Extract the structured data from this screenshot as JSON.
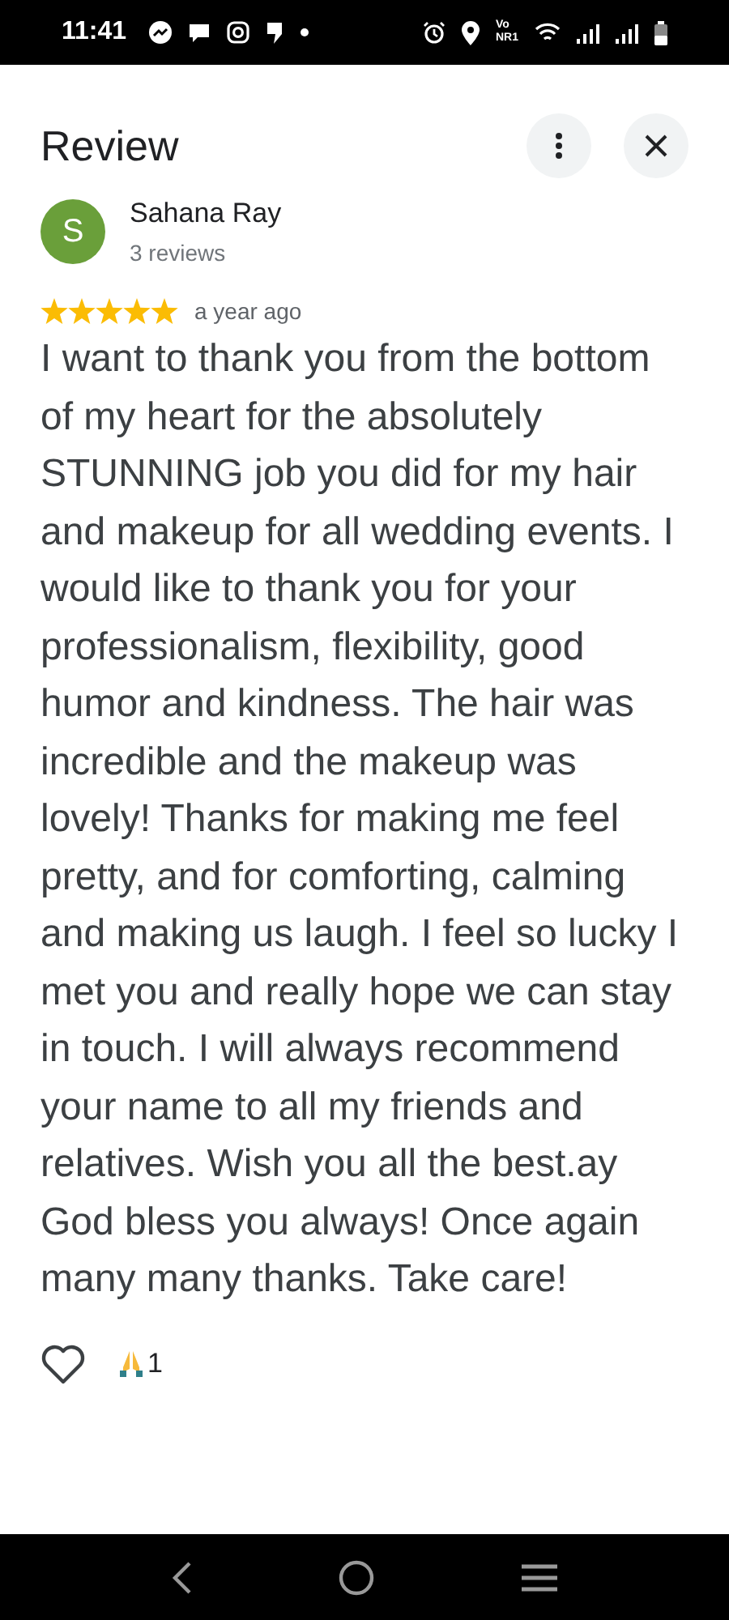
{
  "status_bar": {
    "time": "11:41",
    "network_top": "Vo",
    "network_bottom": "NR1"
  },
  "header": {
    "title": "Review"
  },
  "reviewer": {
    "initial": "S",
    "color": "#6a9f3a",
    "name": "Sahana Ray",
    "reviews": "3 reviews"
  },
  "review": {
    "stars": 5,
    "time": "a year ago",
    "text": "I want to thank you from the bottom of my heart for the absolutely STUNNING job you did for my hair and makeup for all wedding events. I would like to thank you for your professionalism, flexibility, good humor and kindness. The hair was incredible and the makeup was lovely! Thanks for making me feel pretty, and for comforting, calming and making us laugh. I feel so lucky I met you and really hope we can stay in touch. I will always recommend your name to all my friends and relatives. Wish you all the best.ay God bless you always! Once again many many thanks. Take care!"
  },
  "reactions": {
    "liked": false,
    "count": "1"
  }
}
